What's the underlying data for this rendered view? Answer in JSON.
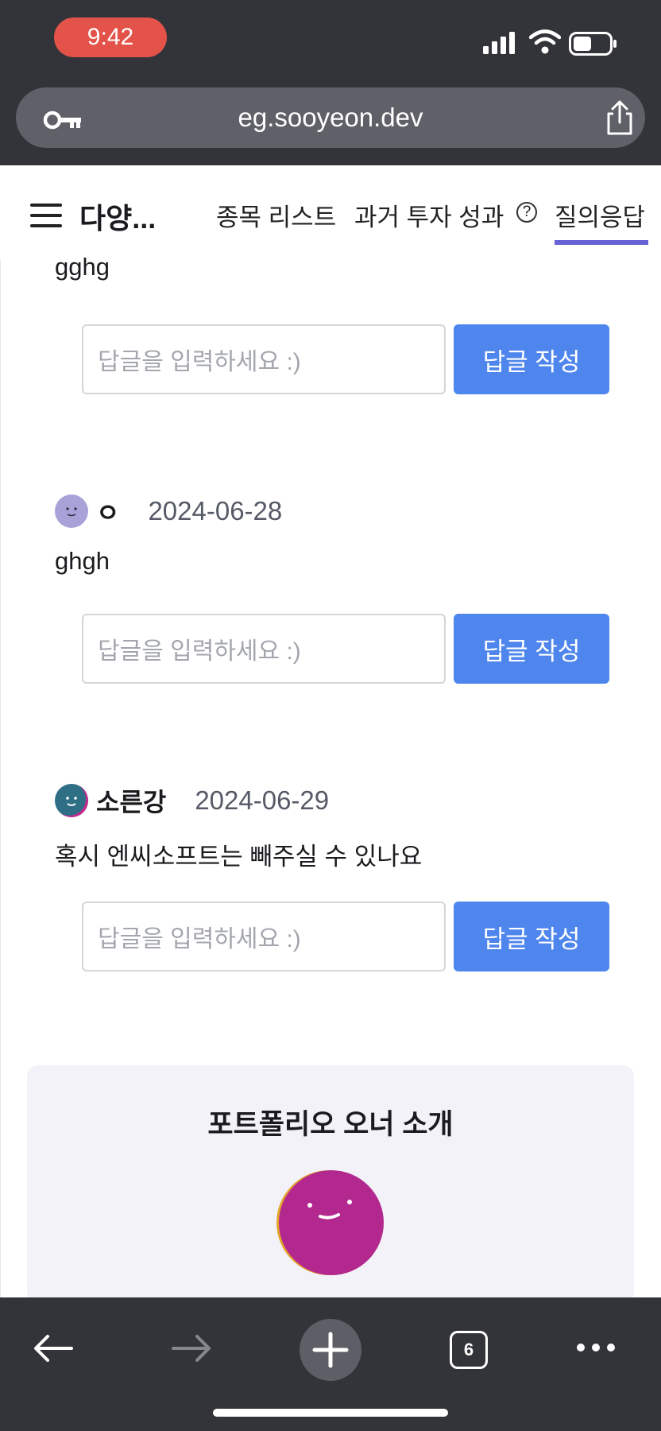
{
  "status": {
    "time": "9:42"
  },
  "browser": {
    "url": "eg.sooyeon.dev",
    "tab_count": "6"
  },
  "nav": {
    "brand": "다양...",
    "tabs": [
      {
        "label": "종목 리스트"
      },
      {
        "label": "과거 투자 성과"
      },
      {
        "label": "질의응답",
        "active": true
      }
    ],
    "help_glyph": "?"
  },
  "comments": [
    {
      "body": "gghg"
    },
    {
      "author": "ㅇ",
      "date": "2024-06-28",
      "body": "ghgh",
      "avatar_color": "#a7a3d8"
    },
    {
      "author": "소른강",
      "date": "2024-06-29",
      "body": "혹시 엔씨소프트는 빼주실 수 있나요",
      "avatar_color": "#2e6f86"
    }
  ],
  "reply": {
    "placeholder": "답글을 입력하세요 :)",
    "button_label": "답글 작성"
  },
  "owner": {
    "title": "포트폴리오 오너 소개",
    "avatar_color": "#b3288e"
  },
  "colors": {
    "accent": "#6763d6",
    "button": "#4f86ee",
    "chrome": "#33343a",
    "time_pill": "#e4534a"
  }
}
